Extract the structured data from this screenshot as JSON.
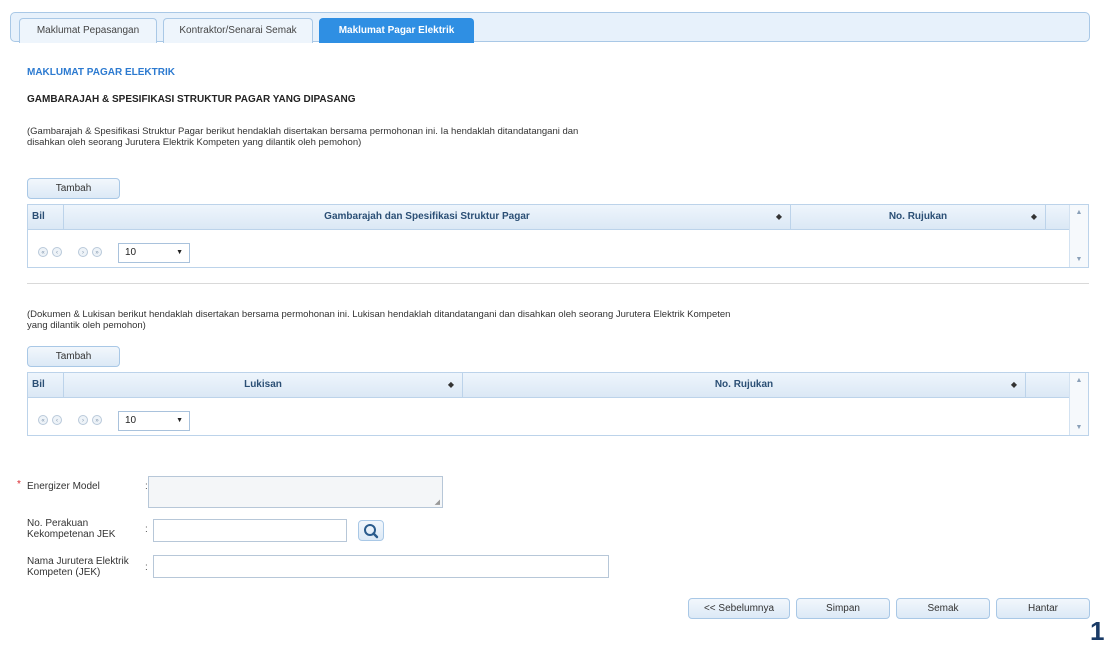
{
  "tabs": [
    {
      "label": "Maklumat Pepasangan",
      "active": false
    },
    {
      "label": "Kontraktor/Senarai Semak",
      "active": false
    },
    {
      "label": "Maklumat Pagar Elektrik",
      "active": true
    }
  ],
  "section_title": "MAKLUMAT PAGAR ELEKTRIK",
  "sub_title": "GAMBARAJAH & SPESIFIKASI STRUKTUR PAGAR YANG DIPASANG",
  "note1": {
    "line1": "(Gambarajah & Spesifikasi Struktur Pagar berikut hendaklah disertakan bersama permohonan ini. Ia hendaklah ditandatangani dan",
    "line2": "disahkan oleh seorang Jurutera Elektrik Kompeten yang dilantik oleh pemohon)"
  },
  "grid1": {
    "add_label": "Tambah",
    "columns": [
      "Bil",
      "Gambarajah dan Spesifikasi Struktur Pagar",
      "No. Rujukan"
    ],
    "page_size": "10"
  },
  "note2": {
    "line1": "(Dokumen & Lukisan berikut hendaklah disertakan bersama permohonan ini. Lukisan hendaklah ditandatangani dan disahkan oleh seorang Jurutera Elektrik Kompeten",
    "line2": "yang dilantik oleh pemohon)"
  },
  "grid2": {
    "add_label": "Tambah",
    "columns": [
      "Bil",
      "Lukisan",
      "No. Rujukan"
    ],
    "page_size": "10"
  },
  "form": {
    "required_mark": "*",
    "energizer_label": "Energizer Model",
    "energizer_value": "",
    "perakuan_label_1": "No. Perakuan",
    "perakuan_label_2": "Kekompetenan JEK",
    "perakuan_value": "",
    "nama_label_1": "Nama Jurutera Elektrik",
    "nama_label_2": "Kompeten (JEK)",
    "nama_value": "",
    "colon": ":"
  },
  "footer": {
    "prev_label": "<< Sebelumnya",
    "save_label": "Simpan",
    "check_label": "Semak",
    "send_label": "Hantar"
  },
  "page_marker": "1",
  "colors": {
    "accent": "#2f8fe3",
    "title_blue": "#2c7ad0",
    "required": "#d9262c"
  }
}
